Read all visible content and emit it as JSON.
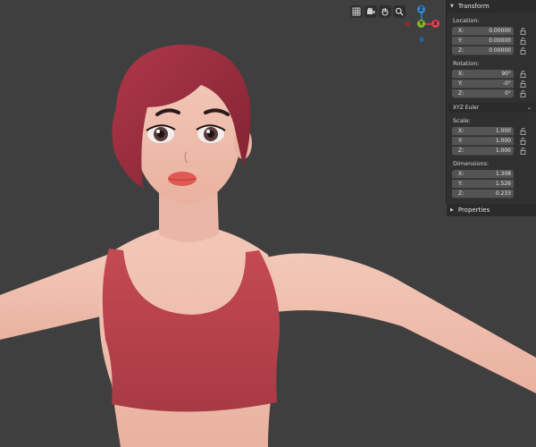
{
  "gizmo": {
    "axes": {
      "z": "Z",
      "y": "Y",
      "x": "X"
    },
    "colors": {
      "x": "#e5414f",
      "y": "#85b626",
      "z": "#3386d6"
    }
  },
  "view_buttons": [
    "grid-icon",
    "camera-icon",
    "hand-icon",
    "zoom-icon"
  ],
  "sidebar": {
    "transform_header": "Transform",
    "location": {
      "label": "Location:",
      "x_label": "X:",
      "x": "0.00000",
      "y_label": "Y:",
      "y": "0.00000",
      "z_label": "Z:",
      "z": "0.00000"
    },
    "rotation": {
      "label": "Rotation:",
      "x_label": "X:",
      "x": "90°",
      "y_label": "Y:",
      "y": "-0°",
      "z_label": "Z:",
      "z": "0°"
    },
    "rotation_mode": "XYZ Euler",
    "scale": {
      "label": "Scale:",
      "x_label": "X:",
      "x": "1.000",
      "y_label": "Y:",
      "y": "1.000",
      "z_label": "Z:",
      "z": "1.000"
    },
    "dimensions": {
      "label": "Dimensions:",
      "x_label": "X:",
      "x": "1.308",
      "y_label": "Y:",
      "y": "1.526",
      "z_label": "Z:",
      "z": "0.233"
    },
    "properties_header": "Properties"
  }
}
